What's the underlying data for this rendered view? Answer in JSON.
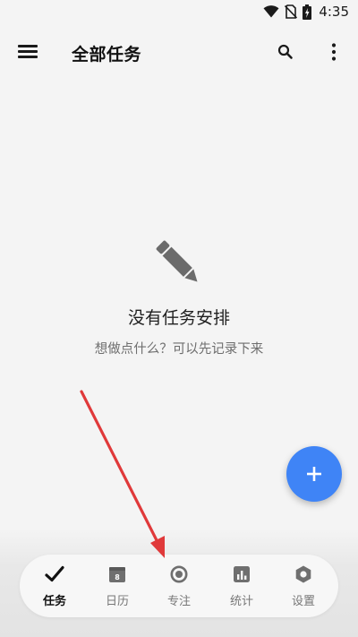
{
  "status_bar": {
    "time": "4:35",
    "icons": [
      "wifi-icon",
      "no-sim-icon",
      "battery-charging-icon"
    ]
  },
  "app_bar": {
    "title": "全部任务",
    "icons": [
      "menu-icon",
      "search-icon",
      "more-vertical-icon"
    ]
  },
  "empty_state": {
    "icon": "pencil-icon",
    "title": "没有任务安排",
    "subtitle": "想做点什么？可以先记录下来"
  },
  "fab": {
    "icon": "plus-icon",
    "color": "#3f84f6"
  },
  "bottom_nav": {
    "items": [
      {
        "label": "任务",
        "icon": "check-icon",
        "active": true
      },
      {
        "label": "日历",
        "icon": "calendar-icon",
        "active": false,
        "calendar_day": "8"
      },
      {
        "label": "专注",
        "icon": "focus-target-icon",
        "active": false
      },
      {
        "label": "统计",
        "icon": "bar-chart-icon",
        "active": false
      },
      {
        "label": "设置",
        "icon": "hexagon-settings-icon",
        "active": false
      }
    ]
  },
  "annotation": {
    "type": "arrow",
    "color": "#e0393a"
  }
}
